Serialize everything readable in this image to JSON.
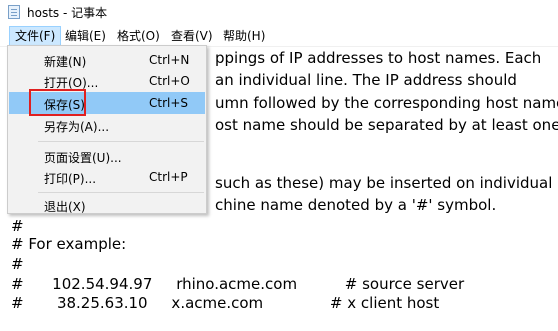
{
  "window": {
    "title": "hosts - 记事本"
  },
  "menubar": [
    {
      "label": "文件(F)",
      "active": true
    },
    {
      "label": "编辑(E)"
    },
    {
      "label": "格式(O)"
    },
    {
      "label": "查看(V)"
    },
    {
      "label": "帮助(H)"
    }
  ],
  "file_menu": {
    "items": [
      {
        "label": "新建(N)",
        "shortcut": "Ctrl+N"
      },
      {
        "label": "打开(O)...",
        "shortcut": "Ctrl+O"
      },
      {
        "label": "保存(S)",
        "shortcut": "Ctrl+S",
        "highlighted": true
      },
      {
        "label": "另存为(A)...",
        "shortcut": ""
      },
      {
        "label": "页面设置(U)...",
        "shortcut": ""
      },
      {
        "label": "打印(P)...",
        "shortcut": "Ctrl+P"
      },
      {
        "label": "退出(X)",
        "shortcut": ""
      }
    ],
    "highlight_color": "#91c9f7",
    "annotation_color": "#e02020"
  },
  "editor": {
    "lines": [
      "ppings of IP addresses to host names. Each",
      "an individual line. The IP address should",
      "umn followed by the corresponding host name.",
      "ost name should be separated by at least one",
      "such as these) may be inserted on individual",
      "chine name denoted by a '#' symbol.",
      "#",
      "# For example:",
      "#",
      "#      102.54.94.97     rhino.acme.com          # source server",
      "#       38.25.63.10     x.acme.com              # x client host"
    ]
  }
}
